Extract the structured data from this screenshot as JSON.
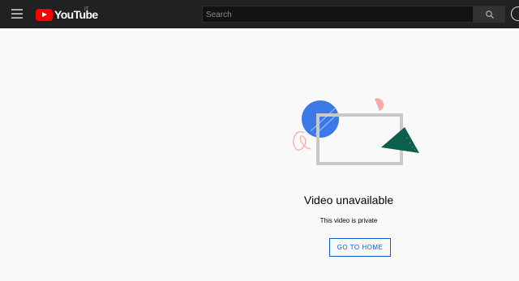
{
  "header": {
    "logo_text": "YouTube",
    "country_code": "IT",
    "search_placeholder": "Search"
  },
  "message": {
    "title": "Video unavailable",
    "subtitle": "This video is private",
    "home_button": "GO TO HOME"
  },
  "colors": {
    "topbar": "#212121",
    "brand_red": "#ff0000",
    "link_blue": "#065fd4",
    "background": "#f9f9f9"
  }
}
